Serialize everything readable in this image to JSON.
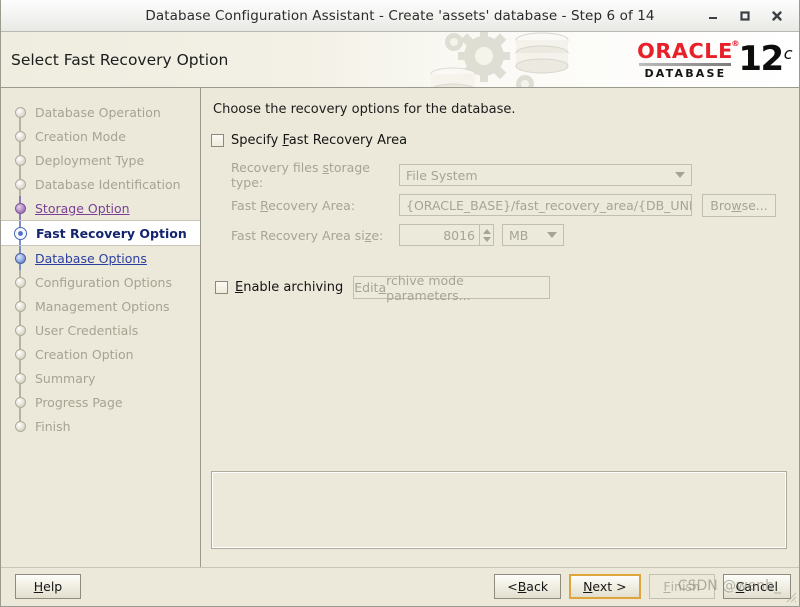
{
  "window": {
    "title": "Database Configuration Assistant - Create 'assets' database - Step 6 of 14",
    "minimize_label": "minimize",
    "maximize_label": "maximize",
    "close_label": "close"
  },
  "banner": {
    "title": "Select Fast Recovery Option",
    "logo": {
      "brand": "ORACLE",
      "trademark": "®",
      "product": "DATABASE",
      "version_number": "12",
      "version_suffix": "c"
    },
    "colors": {
      "oracle_red": "#e8202a",
      "background": "#ece9da"
    }
  },
  "sidebar": {
    "items": [
      {
        "label": "Database Operation",
        "state": "done"
      },
      {
        "label": "Creation Mode",
        "state": "done"
      },
      {
        "label": "Deployment Type",
        "state": "done"
      },
      {
        "label": "Database Identification",
        "state": "done"
      },
      {
        "label": "Storage Option",
        "state": "visited"
      },
      {
        "label": "Fast Recovery Option",
        "state": "current"
      },
      {
        "label": "Database Options",
        "state": "next"
      },
      {
        "label": "Configuration Options",
        "state": "pending"
      },
      {
        "label": "Management Options",
        "state": "pending"
      },
      {
        "label": "User Credentials",
        "state": "pending"
      },
      {
        "label": "Creation Option",
        "state": "pending"
      },
      {
        "label": "Summary",
        "state": "pending"
      },
      {
        "label": "Progress Page",
        "state": "pending"
      },
      {
        "label": "Finish",
        "state": "pending"
      }
    ]
  },
  "main": {
    "intro": "Choose the recovery options for the database.",
    "specify_fra": {
      "label_pre": "Specify ",
      "label_mnemonic": "F",
      "label_post": "ast Recovery Area",
      "checked": false
    },
    "storage_type": {
      "label_pre": "Recovery files ",
      "label_mnemonic": "s",
      "label_post": "torage type:",
      "value": "File System",
      "enabled": false
    },
    "fra_path": {
      "label_pre": "Fast ",
      "label_mnemonic": "R",
      "label_post": "ecovery Area:",
      "value": "{ORACLE_BASE}/fast_recovery_area/{DB_UNIQUE_",
      "enabled": false,
      "browse_label_pre": "Bro",
      "browse_mnemonic": "w",
      "browse_label_post": "se..."
    },
    "fra_size": {
      "label_pre": "Fast Recovery Area si",
      "label_mnemonic": "z",
      "label_post": "e:",
      "value": "8016",
      "unit": "MB",
      "enabled": false
    },
    "enable_archiving": {
      "label_mnemonic": "E",
      "label_post": "nable archiving",
      "checked": false,
      "button_label_pre": "Edit ",
      "button_mnemonic": "a",
      "button_label_post": "rchive mode parameters...",
      "button_enabled": false
    },
    "message_panel": ""
  },
  "footer": {
    "help": {
      "pre": "",
      "mnemonic": "H",
      "post": "elp",
      "enabled": true,
      "focused": false
    },
    "back": {
      "pre": "< ",
      "mnemonic": "B",
      "post": "ack",
      "enabled": true,
      "focused": false
    },
    "next": {
      "pre": "",
      "mnemonic": "N",
      "post": "ext >",
      "enabled": true,
      "focused": true
    },
    "finish": {
      "pre": "",
      "mnemonic": "F",
      "post": "inish",
      "enabled": false,
      "focused": false
    },
    "cancel": {
      "pre": "",
      "mnemonic": "C",
      "post": "ancel",
      "enabled": true,
      "focused": false
    },
    "watermark": "CSDN @wenb_"
  }
}
